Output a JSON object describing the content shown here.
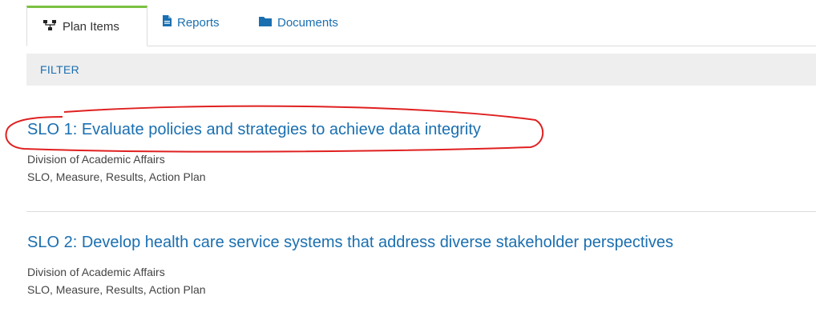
{
  "tabs": [
    {
      "label": "Plan Items",
      "icon": "hierarchy-icon",
      "active": true
    },
    {
      "label": "Reports",
      "icon": "file-icon",
      "active": false
    },
    {
      "label": "Documents",
      "icon": "folder-icon",
      "active": false
    }
  ],
  "filter": {
    "label": "FILTER"
  },
  "items": [
    {
      "title": "SLO 1: Evaluate policies and strategies to achieve data integrity",
      "division": "Division of Academic Affairs",
      "components": "SLO, Measure, Results, Action Plan"
    },
    {
      "title": "SLO 2: Develop health care service systems that address diverse stakeholder perspectives",
      "division": "Division of Academic Affairs",
      "components": "SLO, Measure, Results, Action Plan"
    }
  ],
  "colors": {
    "link": "#1a6fb0",
    "active_tab_accent": "#7ac142",
    "annotation": "#e02020",
    "filter_bg": "#eeeeee"
  }
}
